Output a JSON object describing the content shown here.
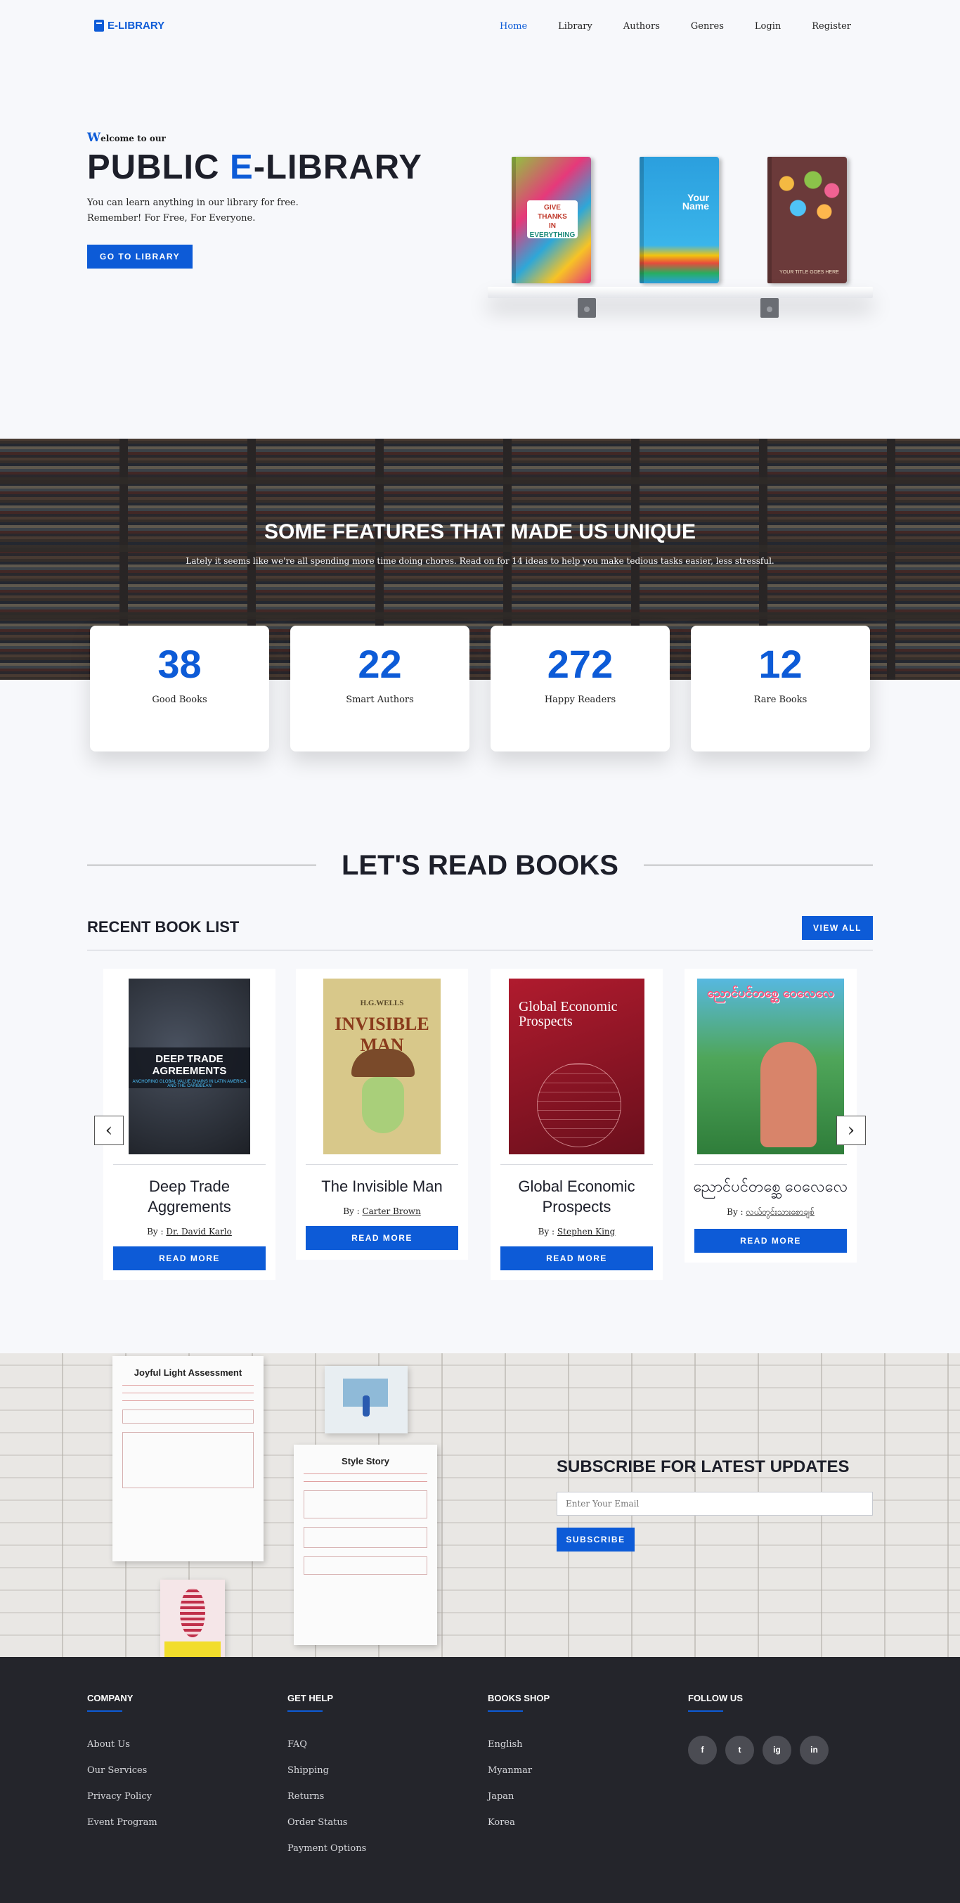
{
  "nav": {
    "logo": "E-LIBRARY",
    "items": [
      "Home",
      "Library",
      "Authors",
      "Genres",
      "Login",
      "Register"
    ]
  },
  "hero": {
    "welcome_initial": "W",
    "welcome_rest": "elcome to our",
    "title_part1": "PUBLIC ",
    "title_accent": "E",
    "title_part2": "-LIBRARY",
    "line1": "You can learn anything in our library for free.",
    "line2": "Remember! For Free, For Everyone.",
    "button": "GO TO LIBRARY",
    "books": [
      {
        "l1": "GIVE",
        "l2": "THANKS",
        "l3": "IN",
        "l4": "EVERYTHING"
      },
      {
        "l1": "Your",
        "l2": "Name"
      },
      {
        "l1": "YOUR TITLE GOES HERE"
      }
    ]
  },
  "features": {
    "title": "SOME FEATURES THAT MADE US UNIQUE",
    "subtitle": "Lately it seems like we're all spending more time doing chores. Read on for 14 ideas to help you make tedious tasks easier, less stressful.",
    "stats": [
      {
        "num": "38",
        "label": "Good Books"
      },
      {
        "num": "22",
        "label": "Smart Authors"
      },
      {
        "num": "272",
        "label": "Happy Readers"
      },
      {
        "num": "12",
        "label": "Rare Books"
      }
    ]
  },
  "books_section": {
    "title": "LET'S READ BOOKS",
    "recent": "RECENT BOOK LIST",
    "view_all": "VIEW ALL",
    "by_label": "By : ",
    "read_more": "READ MORE",
    "prev_arrow": "‹",
    "next_arrow": "›",
    "books": [
      {
        "title": "Deep Trade Aggrements",
        "author": "Dr. David Karlo",
        "cover_text": "DEEP TRADE AGREEMENTS",
        "cover_sub": "ANCHORING GLOBAL VALUE CHAINS IN LATIN AMERICA AND THE CARIBBEAN"
      },
      {
        "title": "The Invisible Man",
        "author": "Carter Brown",
        "cover_text": "INVISIBLE MAN",
        "cover_sub": "H.G.WELLS"
      },
      {
        "title": "Global Economic Prospects",
        "author": "Stephen King",
        "cover_text": "Global Economic Prospects",
        "cover_sub": ""
      },
      {
        "title": "ညောင်ပင်တစ္ဆေ ဝေလေလေ",
        "author": "လယ်တွင်းသားစောချစ်",
        "cover_text": "ညောင်ပင်တစ္ဆေ ဝေလေလေ",
        "cover_sub": ""
      }
    ]
  },
  "subscribe": {
    "title": "SUBSCRIBE FOR LATEST UPDATES",
    "placeholder": "Enter Your Email",
    "button": "SUBSCRIBE",
    "paper1_title": "Joyful Light Assessment",
    "paper2_title": "Style Story"
  },
  "footer": {
    "company": {
      "title": "COMPANY",
      "links": [
        "About Us",
        "Our Services",
        "Privacy Policy",
        "Event Program"
      ]
    },
    "help": {
      "title": "GET HELP",
      "links": [
        "FAQ",
        "Shipping",
        "Returns",
        "Order Status",
        "Payment Options"
      ]
    },
    "shop": {
      "title": "BOOKS SHOP",
      "links": [
        "English",
        "Myanmar",
        "Japan",
        "Korea"
      ]
    },
    "follow": {
      "title": "FOLLOW US",
      "icons": [
        "f",
        "t",
        "ig",
        "in"
      ]
    }
  },
  "colors": {
    "accent": "#0d5bd7",
    "dark": "#1d1f2a",
    "footer": "#24252b"
  }
}
